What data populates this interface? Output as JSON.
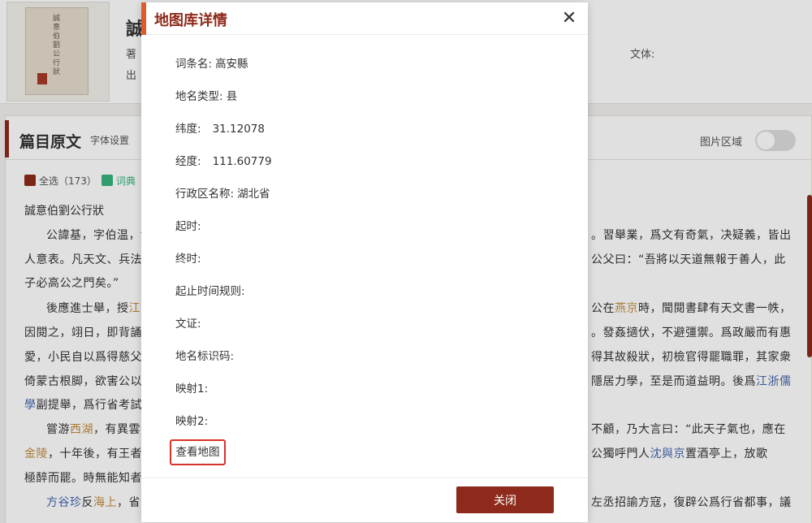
{
  "book": {
    "title": "誠",
    "cover_title": "誠意伯劉公行狀",
    "meta_line1": "著",
    "meta_line2": "出",
    "wenti_label": "文体:"
  },
  "section": {
    "title": "篇目原文",
    "font_setting": "字体设置",
    "image_area_label": "图片区域",
    "select_all": "全选（173）",
    "term_filter": "词典"
  },
  "document": {
    "title": "誠意伯劉公行狀",
    "lines": [
      {
        "left": "公諱基，字伯温，t",
        "right": "。習舉業，爲文有奇氣，决疑義，皆出"
      },
      {
        "left": "人意表。凡天文、兵法",
        "right": "公父曰：“吾將以天道無報于善人，此"
      },
      {
        "left": "子必高公之門矣。”",
        "right": ""
      },
      {
        "left": "後應進士舉，授",
        "place": "江",
        "right_pre": "公在",
        "right_place": "燕京",
        "right": "時，聞閱書肆有天文書一帙，"
      },
      {
        "left": "因閱之，翊日，即背誦",
        "right": "。發姦擿伏，不避彊禦。爲政嚴而有惠"
      },
      {
        "left": "愛，小民自以爲得慈父",
        "right": "得其故殺狀，初檢官得罷職罪，其家衆"
      },
      {
        "left": "倚蒙古根脚，欲害公以",
        "right_pre": "隱居力學，至是而道益明。後爲",
        "right_place": "江浙儒",
        "right": ""
      },
      {
        "left_place": "學",
        "left": "副提舉，爲行省考試",
        "right": ""
      },
      {
        "left_pre": "嘗游",
        "left_place": "西湖",
        "left": "，有異雲",
        "right": "不顧，乃大言曰：“此天子氣也，應在"
      },
      {
        "left_place": "金陵",
        "left": "，十年後，有王者",
        "right_pre": "公獨呼門人",
        "right_person": "沈與京",
        "right": "置酒亭上，放歌"
      },
      {
        "left": "極醉而罷。時無能知者",
        "right": ""
      },
      {
        "left_person": "方谷珍",
        "left_pre": "反",
        "left_place": "海上",
        "left": "，省",
        "right": "左丞招諭方寇，復辟公爲行省都事，議"
      }
    ]
  },
  "modal": {
    "title": "地图库详情",
    "close_icon": "✕",
    "fields": {
      "name_label": "词条名:",
      "name_value": "高安縣",
      "type_label": "地名类型:",
      "type_value": "县",
      "lat_label": "纬度:",
      "lat_value": "31.12078",
      "lng_label": "经度:",
      "lng_value": "111.60779",
      "admin_label": "行政区名称:",
      "admin_value": "湖北省",
      "start_label": "起时:",
      "end_label": "终时:",
      "rule_label": "起止时间规则:",
      "evidence_label": "文证:",
      "code_label": "地名标识码:",
      "map1_label": "映射1:",
      "map2_label": "映射2:"
    },
    "view_map": "查看地图",
    "close_button": "关闭"
  },
  "colors": {
    "brand": "#8e2a1b",
    "accent": "#e05b2b",
    "highlight_border": "#d9322a",
    "term_green": "#36b37e"
  }
}
